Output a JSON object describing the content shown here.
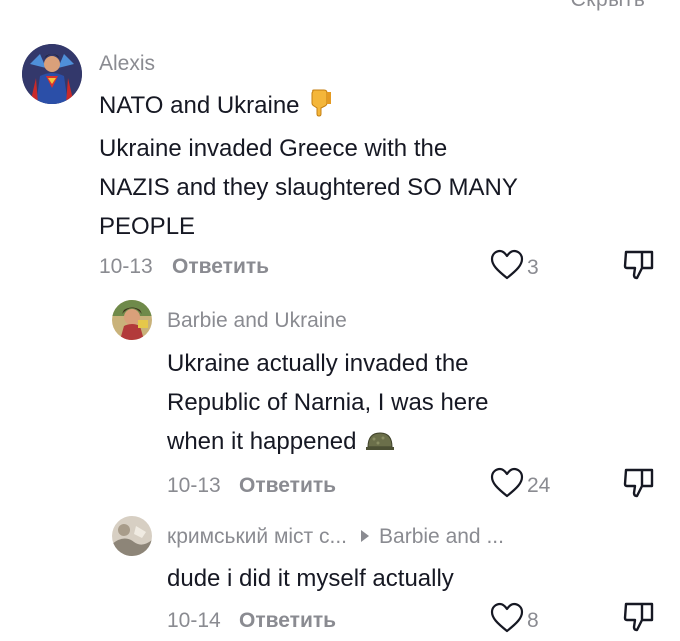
{
  "header": {
    "hide_label": "Скрыть ^"
  },
  "comments": [
    {
      "username": "Alexis",
      "lines": [
        "NATO and Ukraine",
        "Ukraine invaded Greece with the",
        "NAZIS and they slaughtered SO MANY",
        "PEOPLE"
      ],
      "emoji": "thumbs-down-emoji",
      "date": "10-13",
      "reply_label": "Ответить",
      "likes": "3"
    },
    {
      "username": "Barbie and Ukraine",
      "lines": [
        "Ukraine actually invaded the",
        "Republic of Narnia, I was here",
        "when it happened"
      ],
      "emoji": "military-helmet-emoji",
      "date": "10-13",
      "reply_label": "Ответить",
      "likes": "24"
    },
    {
      "username": "кримський міст с...",
      "reply_to": "Barbie and ...",
      "lines": [
        "dude i did it myself actually"
      ],
      "date": "10-14",
      "reply_label": "Ответить",
      "likes": "8"
    }
  ],
  "colors": {
    "text": "#161823",
    "muted": "#8a8b91",
    "background": "#ffffff"
  }
}
